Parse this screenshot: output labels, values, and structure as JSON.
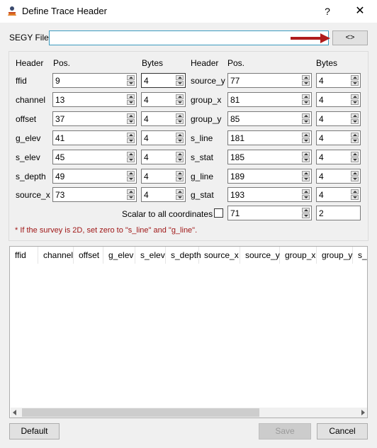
{
  "window": {
    "title": "Define Trace Header",
    "help": "?",
    "close": "✕"
  },
  "segy": {
    "label": "SEGY File:",
    "value": "",
    "browse_label": "<>"
  },
  "columns": {
    "header": "Header",
    "pos": "Pos.",
    "bytes": "Bytes"
  },
  "left_rows": [
    {
      "name": "ffid",
      "pos": "9",
      "bytes": "4"
    },
    {
      "name": "channel",
      "pos": "13",
      "bytes": "4"
    },
    {
      "name": "offset",
      "pos": "37",
      "bytes": "4"
    },
    {
      "name": "g_elev",
      "pos": "41",
      "bytes": "4"
    },
    {
      "name": "s_elev",
      "pos": "45",
      "bytes": "4"
    },
    {
      "name": "s_depth",
      "pos": "49",
      "bytes": "4"
    },
    {
      "name": "source_x",
      "pos": "73",
      "bytes": "4"
    }
  ],
  "right_rows": [
    {
      "name": "source_y",
      "pos": "77",
      "bytes": "4"
    },
    {
      "name": "group_x",
      "pos": "81",
      "bytes": "4"
    },
    {
      "name": "group_y",
      "pos": "85",
      "bytes": "4"
    },
    {
      "name": "s_line",
      "pos": "181",
      "bytes": "4"
    },
    {
      "name": "s_stat",
      "pos": "185",
      "bytes": "4"
    },
    {
      "name": "g_line",
      "pos": "189",
      "bytes": "4"
    },
    {
      "name": "g_stat",
      "pos": "193",
      "bytes": "4"
    }
  ],
  "scalar": {
    "label": "Scalar to all coordinates",
    "pos": "71",
    "bytes": "2"
  },
  "note": "* If the survey is 2D, set zero to \"s_line\" and \"g_line\".",
  "table_headers": [
    "ffid",
    "channel",
    "offset",
    "g_elev",
    "s_elev",
    "s_depth",
    "source_x",
    "source_y",
    "group_x",
    "group_y",
    "s_l"
  ],
  "buttons": {
    "default": "Default",
    "save": "Save",
    "cancel": "Cancel"
  },
  "colors": {
    "note": "#a01818",
    "focus_border": "#3c9bbf",
    "arrow": "#b01c1c"
  }
}
